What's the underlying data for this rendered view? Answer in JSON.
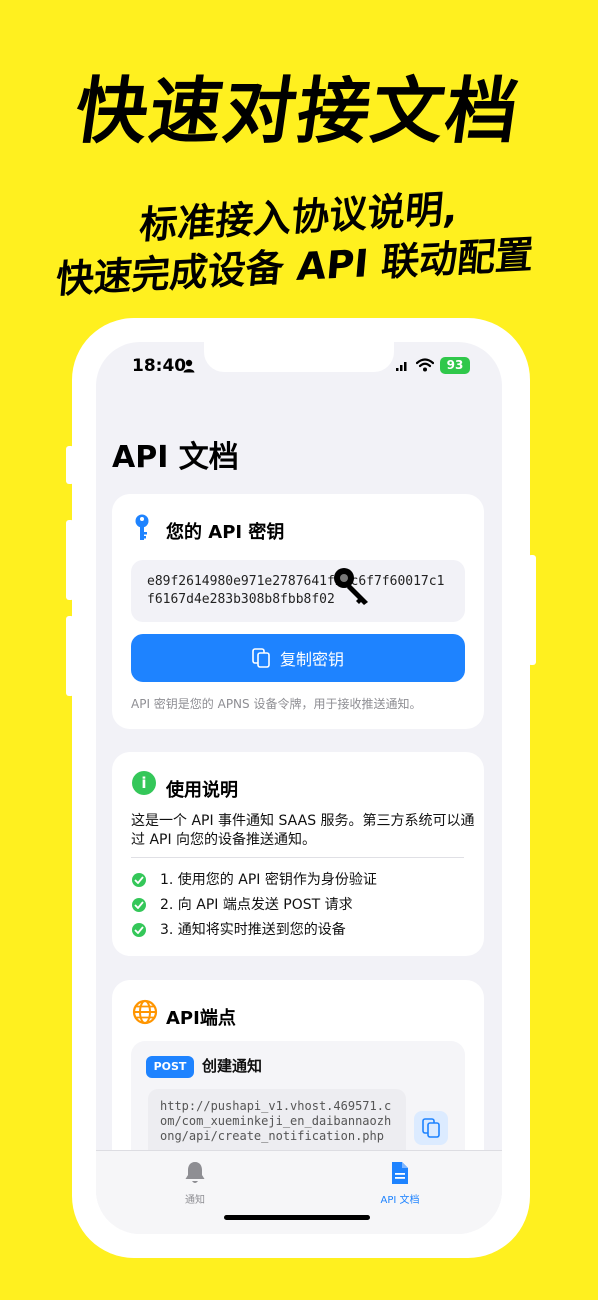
{
  "promo": {
    "headline": "快速对接文档",
    "sub_line1": "标准接入协议说明,",
    "sub_line2": "快速完成设备 API 联动配置"
  },
  "status_bar": {
    "time": "18:40",
    "battery": "93"
  },
  "page_title": "API 文档",
  "api_key_card": {
    "title": "您的 API 密钥",
    "key_value": "e89f2614980e971e2787641f2fc6f7f60017c1f6167d4e283b308b8fbb8f02",
    "copy_button_label": "复制密钥",
    "hint": "API 密钥是您的 APNS 设备令牌，用于接收推送通知。"
  },
  "usage_card": {
    "title": "使用说明",
    "description": "这是一个 API 事件通知 SAAS 服务。第三方系统可以通过 API 向您的设备推送通知。",
    "steps": [
      "1. 使用您的 API 密钥作为身份验证",
      "2. 向 API 端点发送 POST 请求",
      "3. 通知将实时推送到您的设备"
    ]
  },
  "endpoint_card": {
    "title": "API端点",
    "method": "POST",
    "endpoint_name": "创建通知",
    "url": "http://pushapi_v1.vhost.469571.com/com_xueminkeji_en_daibannaozhong/api/create_notification.php"
  },
  "tabs": [
    {
      "label": "通知",
      "icon": "bell-icon",
      "active": false
    },
    {
      "label": "API 文档",
      "icon": "document-icon",
      "active": true
    }
  ],
  "colors": {
    "background": "#FFF01F",
    "accent": "#1E83FF",
    "success": "#34C759",
    "inactive_tab": "#8E8E93"
  }
}
